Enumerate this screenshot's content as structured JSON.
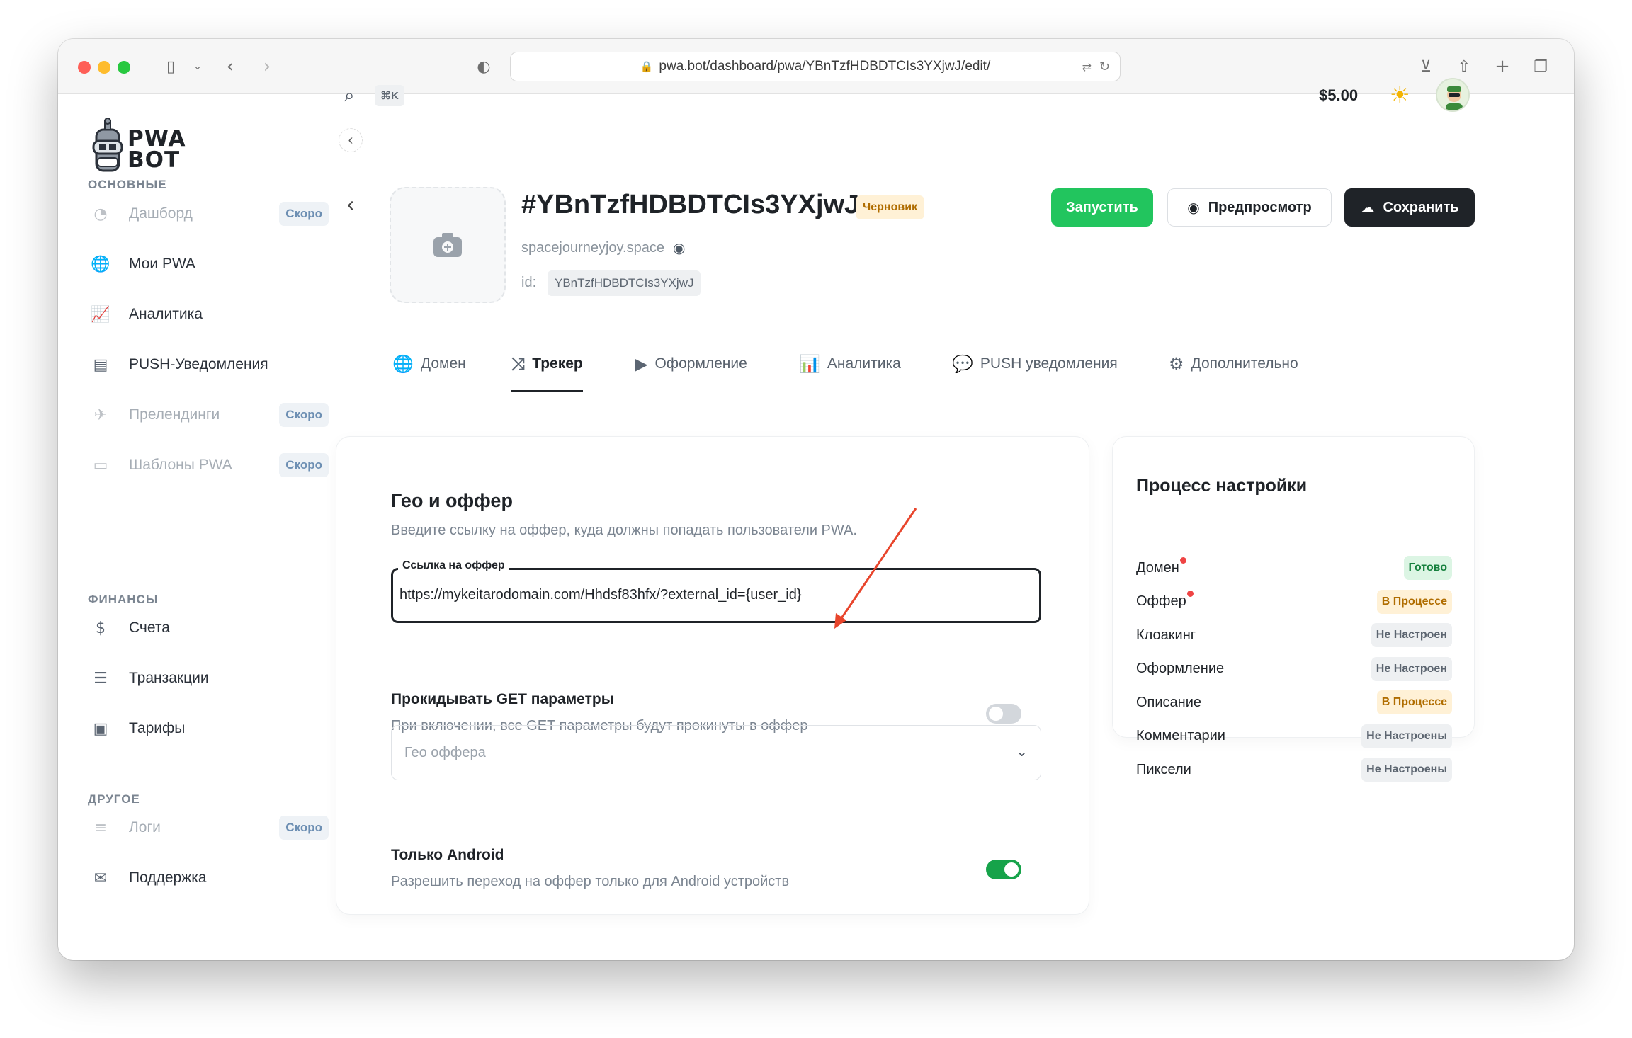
{
  "browser": {
    "url": "pwa.bot/dashboard/pwa/YBnTzfHDBDTCIs3YXjwJ/edit/"
  },
  "sidebar": {
    "logo_line1": "PWA",
    "logo_line2": "BOT",
    "sections": {
      "main": "ОСНОВНЫЕ",
      "finance": "ФИНАНСЫ",
      "other": "ДРУГОЕ"
    },
    "items": [
      {
        "label": "Дашборд",
        "badge": "Скоро",
        "icon": "dashboard-icon"
      },
      {
        "label": "Мои PWA",
        "icon": "globe-icon"
      },
      {
        "label": "Аналитика",
        "icon": "chart-icon"
      },
      {
        "label": "PUSH-Уведомления",
        "icon": "notification-icon"
      },
      {
        "label": "Прелендинги",
        "badge": "Скоро",
        "icon": "landing-icon"
      },
      {
        "label": "Шаблоны PWA",
        "badge": "Скоро",
        "icon": "template-icon"
      },
      {
        "label": "Счета",
        "icon": "invoice-icon"
      },
      {
        "label": "Транзакции",
        "icon": "transactions-icon"
      },
      {
        "label": "Тарифы",
        "icon": "tariff-icon"
      },
      {
        "label": "Логи",
        "badge": "Скоро",
        "icon": "logs-icon"
      },
      {
        "label": "Поддержка",
        "icon": "support-icon"
      }
    ]
  },
  "header": {
    "shortcut": "⌘K",
    "balance": "$5.00"
  },
  "pwa": {
    "title": "#YBnTzfHDBDTCIs3YXjwJ",
    "status": "Черновик",
    "domain": "spacejourneyjoy.space",
    "id_label": "id:",
    "id": "YBnTzfHDBDTCIs3YXjwJ",
    "buttons": {
      "run": "Запустить",
      "preview": "Предпросмотр",
      "save": "Сохранить"
    }
  },
  "tabs": [
    {
      "label": "Домен",
      "icon": "globe-icon"
    },
    {
      "label": "Трекер",
      "icon": "shuffle-icon",
      "active": true
    },
    {
      "label": "Оформление",
      "icon": "play-icon"
    },
    {
      "label": "Аналитика",
      "icon": "analytics-icon"
    },
    {
      "label": "PUSH уведомления",
      "icon": "chat-icon"
    },
    {
      "label": "Дополнительно",
      "icon": "gear-icon"
    }
  ],
  "form": {
    "title": "Гео и оффер",
    "subtitle": "Введите ссылку на оффер, куда должны попадать пользователи PWA.",
    "offer_label": "Ссылка на оффер",
    "offer_value": "https://mykeitarodomain.com/Hhdsf83hfx/?external_id={user_id}",
    "get_params_title": "Прокидывать GET параметры",
    "get_params_sub": "При включении, все GET параметры будут прокинуты в оффер",
    "get_params_on": false,
    "geo_placeholder": "Гео оффера",
    "android_title": "Только Android",
    "android_sub": "Разрешить переход на оффер только для Android устройств",
    "android_on": true
  },
  "progress": {
    "title": "Процесс настройки",
    "rows": [
      {
        "label": "Домен",
        "status": "Готово",
        "kind": "ready",
        "dot": true
      },
      {
        "label": "Оффер",
        "status": "В Процессе",
        "kind": "progress",
        "dot": true
      },
      {
        "label": "Клоакинг",
        "status": "Не Настроен",
        "kind": "none"
      },
      {
        "label": "Оформление",
        "status": "Не Настроен",
        "kind": "none"
      },
      {
        "label": "Описание",
        "status": "В Процессе",
        "kind": "progress"
      },
      {
        "label": "Комментарии",
        "status": "Не Настроены",
        "kind": "none"
      },
      {
        "label": "Пиксели",
        "status": "Не Настроены",
        "kind": "none"
      }
    ]
  },
  "colors": {
    "accent_green": "#22c55e",
    "dark": "#1f2328",
    "annotation_arrow": "#e8452c"
  }
}
